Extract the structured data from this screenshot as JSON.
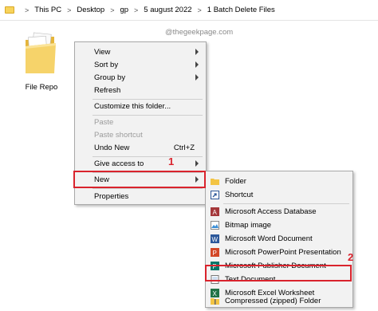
{
  "breadcrumb": {
    "items": [
      "This PC",
      "Desktop",
      "gp",
      "5 august 2022",
      "1 Batch Delete Files"
    ],
    "separator": ">"
  },
  "watermark": "@thegeekpage.com",
  "desktop": {
    "folder_label": "File Repo"
  },
  "context_menu": {
    "items": [
      {
        "label": "View",
        "submenu": true
      },
      {
        "label": "Sort by",
        "submenu": true
      },
      {
        "label": "Group by",
        "submenu": true
      },
      {
        "label": "Refresh"
      },
      {
        "label": "Customize this folder..."
      },
      {
        "label": "Paste",
        "disabled": true
      },
      {
        "label": "Paste shortcut",
        "disabled": true
      },
      {
        "label": "Undo New",
        "shortcut": "Ctrl+Z"
      },
      {
        "label": "Give access to",
        "submenu": true
      },
      {
        "label": "New",
        "submenu": true,
        "highlighted": true
      },
      {
        "label": "Properties"
      }
    ]
  },
  "new_submenu": {
    "items": [
      {
        "label": "Folder",
        "icon": "folder-icon"
      },
      {
        "label": "Shortcut",
        "icon": "shortcut-icon"
      },
      {
        "label": "Microsoft Access Database",
        "icon": "access-icon"
      },
      {
        "label": "Bitmap image",
        "icon": "bitmap-icon"
      },
      {
        "label": "Microsoft Word Document",
        "icon": "word-icon"
      },
      {
        "label": "Microsoft PowerPoint Presentation",
        "icon": "powerpoint-icon"
      },
      {
        "label": "Microsoft Publisher Document",
        "icon": "publisher-icon"
      },
      {
        "label": "Text Document",
        "icon": "text-document-icon",
        "highlighted": true
      },
      {
        "label": "Microsoft Excel Worksheet",
        "icon": "excel-icon"
      },
      {
        "label": "Compressed (zipped) Folder",
        "icon": "zip-folder-icon"
      }
    ]
  },
  "annotations": {
    "step1": "1",
    "step2": "2",
    "color": "#d9232d"
  }
}
